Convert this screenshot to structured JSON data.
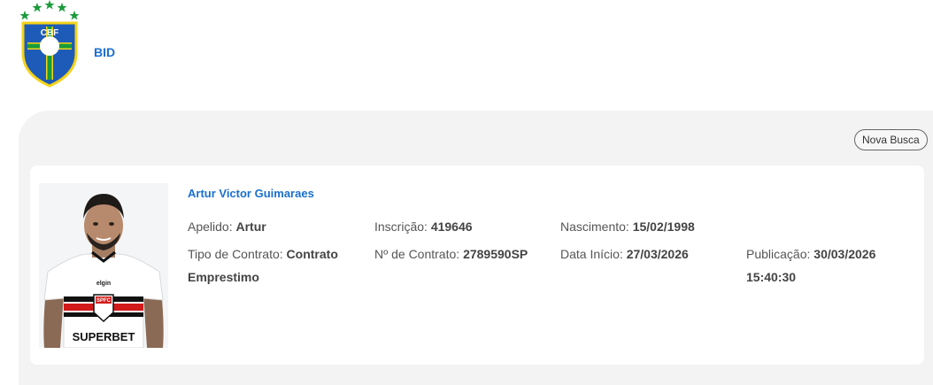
{
  "brand": {
    "logo_text": "CBF",
    "label": "BID"
  },
  "actions": {
    "nova_busca": "Nova Busca"
  },
  "player": {
    "name": "Artur Victor Guimaraes",
    "apelido_label": "Apelido:",
    "apelido": "Artur",
    "inscricao_label": "Inscrição:",
    "inscricao": "419646",
    "nascimento_label": "Nascimento:",
    "nascimento": "15/02/1998",
    "tipo_contrato_label": "Tipo de Contrato:",
    "tipo_contrato_line1": "Contrato",
    "tipo_contrato_line2": "Emprestimo",
    "num_contrato_label": "Nº de Contrato:",
    "num_contrato": "2789590SP",
    "data_inicio_label": "Data Início:",
    "data_inicio": "27/03/2026",
    "publicacao_label": "Publicação:",
    "publicacao_date": "30/03/2026",
    "publicacao_time": "15:40:30",
    "photo": {
      "shirt_club": "SPFC",
      "shirt_sponsor": "SUPERBET",
      "shirt_sponsor_top": "elgin"
    }
  },
  "colors": {
    "accent_blue": "#1a6fd0",
    "cbf_green": "#1a9b3a",
    "cbf_yellow": "#f5d21a",
    "cbf_blue": "#1e5bb8"
  }
}
